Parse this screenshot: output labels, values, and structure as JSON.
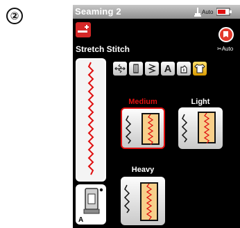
{
  "step_marker": "②",
  "topbar": {
    "title": "Seaming 2",
    "auto_label": "Auto",
    "presser_icon": "presser-foot-icon",
    "battery_icon": "battery-icon"
  },
  "stitch": {
    "mode_icon": "stretch-stitch-icon",
    "name": "Stretch Stitch",
    "back_icon": "back-icon",
    "auto_label": "Auto"
  },
  "foot": {
    "letter": "A",
    "icon": "presser-foot-icon"
  },
  "tools": [
    {
      "icon": "stitch-width-icon",
      "active": false
    },
    {
      "icon": "stitch-length-icon",
      "active": false
    },
    {
      "icon": "pattern-icon",
      "active": false
    },
    {
      "icon": "auto-lock-icon",
      "label": "A",
      "active": false
    },
    {
      "icon": "needle-position-icon",
      "active": false
    },
    {
      "icon": "fabric-shirt-icon",
      "active": true
    }
  ],
  "options": [
    {
      "label": "Medium",
      "selected": true,
      "label_color": "#e01010"
    },
    {
      "label": "Light",
      "selected": false,
      "label_color": "#ffffff"
    },
    {
      "label": "Heavy",
      "selected": false,
      "label_color": "#ffffff"
    }
  ],
  "colors": {
    "background": "#000000",
    "accent_red": "#e01010",
    "active_yellow": "#f2b705",
    "fabric": "#f7cf8a"
  }
}
